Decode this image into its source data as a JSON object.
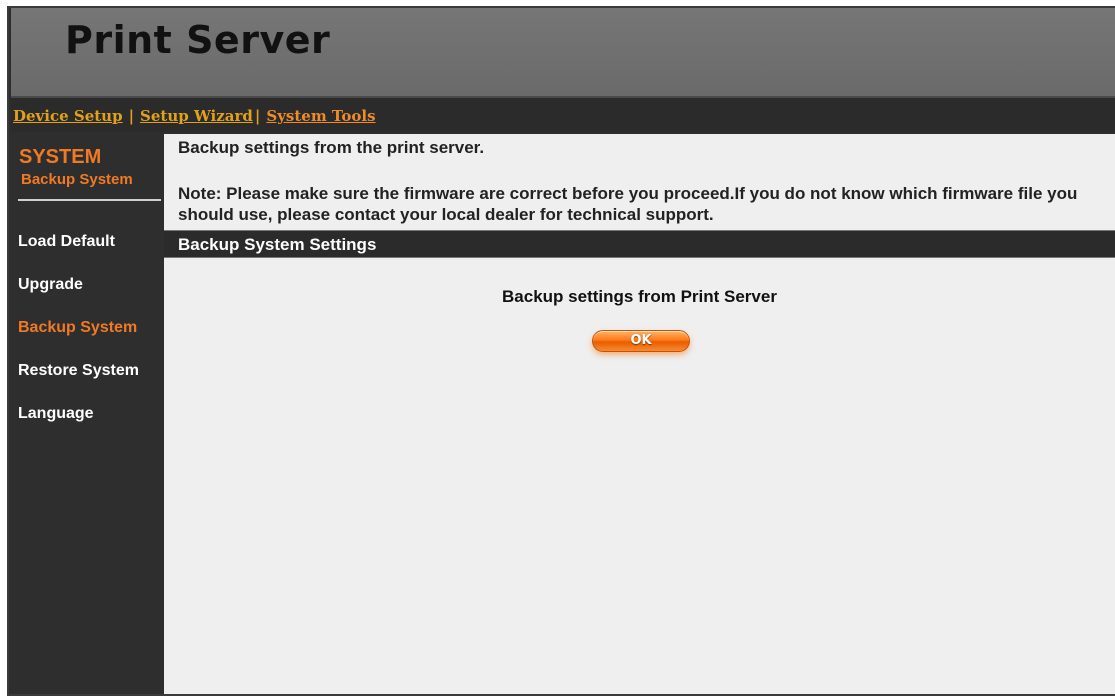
{
  "header": {
    "title": "Print Server"
  },
  "nav": {
    "device_setup": "Device Setup",
    "setup_wizard": "Setup Wizard",
    "system_tools": "System Tools",
    "separator": "|"
  },
  "sidebar": {
    "section": "SYSTEM",
    "subtitle": "Backup System",
    "items": [
      {
        "label": "Load Default",
        "active": false
      },
      {
        "label": "Upgrade",
        "active": false
      },
      {
        "label": "Backup System",
        "active": true
      },
      {
        "label": "Restore System",
        "active": false
      },
      {
        "label": "Language",
        "active": false
      }
    ]
  },
  "main": {
    "intro": "Backup settings from the print server.",
    "note": "Note: Please make sure the firmware are correct before you proceed.If you do not know which firmware file you should use, please contact your local dealer for technical support.",
    "section_title": "Backup System Settings",
    "backup_label": "Backup settings from Print Server",
    "ok_button": "OK"
  },
  "colors": {
    "accent": "#f07a24",
    "nav_link": "#e3a11a",
    "header_bg": "#707070",
    "sidebar_bg": "#2e2e2e",
    "content_bg": "#efefef"
  }
}
